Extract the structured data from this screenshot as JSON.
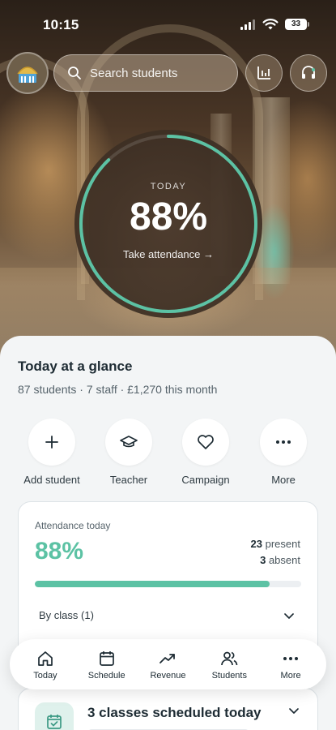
{
  "status_bar": {
    "time": "10:15",
    "battery": "33"
  },
  "search": {
    "placeholder": "Search students"
  },
  "attendance_ring": {
    "label": "TODAY",
    "value": "88%",
    "progress": 0.88,
    "action": "Take attendance →"
  },
  "glance": {
    "title": "Today at a glance",
    "summary": "87 students · 7 staff · £1,270 this month"
  },
  "quick_actions": [
    {
      "label": "Add student",
      "icon": "plus-icon"
    },
    {
      "label": "Teacher",
      "icon": "graduation-cap-icon"
    },
    {
      "label": "Campaign",
      "icon": "heart-icon"
    },
    {
      "label": "More",
      "icon": "more-dots-icon"
    }
  ],
  "attendance_card": {
    "title": "Attendance today",
    "value": "88%",
    "present_count": "23",
    "present_label": "present",
    "absent_count": "3",
    "absent_label": "absent",
    "progress": 0.88,
    "by_class": "By class (1)"
  },
  "schedule_card": {
    "title": "3 classes scheduled today"
  },
  "bottom_nav": [
    {
      "label": "Today",
      "icon": "home-icon"
    },
    {
      "label": "Schedule",
      "icon": "calendar-icon"
    },
    {
      "label": "Revenue",
      "icon": "trending-up-icon"
    },
    {
      "label": "Students",
      "icon": "users-icon"
    },
    {
      "label": "More",
      "icon": "more-dots-icon"
    }
  ],
  "colors": {
    "accent": "#5cc2a4",
    "text_dark": "#1d2b33",
    "sheet_bg": "#f3f5f6"
  }
}
